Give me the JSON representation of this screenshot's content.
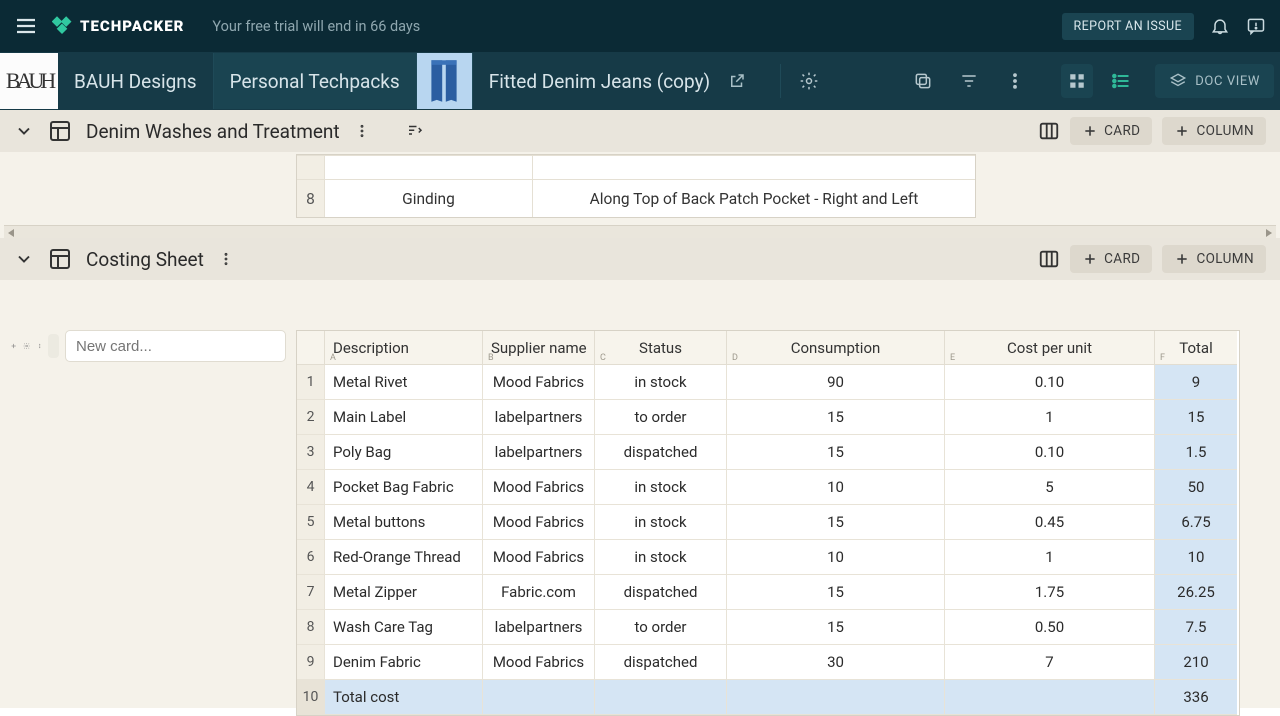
{
  "topbar": {
    "logo": "TECHPACKER",
    "trial": "Your free trial will end in 66 days",
    "report": "REPORT AN ISSUE"
  },
  "nav2": {
    "brand_logo_text": "BAUH",
    "crumb_brand": "BAUH Designs",
    "crumb_collection": "Personal Techpacks",
    "crumb_item": "Fitted Denim Jeans (copy)",
    "doc_view": "DOC VIEW"
  },
  "section1": {
    "title": "Denim Washes and Treatment",
    "card_btn": "CARD",
    "column_btn": "COLUMN",
    "mini_row8_idx": "8",
    "mini_row8_a": "Ginding",
    "mini_row8_b": "Along Top of Back Patch Pocket - Right and Left"
  },
  "section2": {
    "title": "Costing Sheet",
    "card_btn": "CARD",
    "column_btn": "COLUMN",
    "new_card_placeholder": "New card...",
    "headers": {
      "desc": "Description",
      "supp": "Supplier name",
      "stat": "Status",
      "cons": "Consumption",
      "cpu": "Cost per unit",
      "tot": "Total"
    },
    "letters": {
      "desc": "A",
      "supp": "B",
      "stat": "C",
      "cons": "D",
      "cpu": "E",
      "tot": "F"
    },
    "rows": [
      {
        "idx": "1",
        "desc": "Metal Rivet",
        "supp": "Mood Fabrics",
        "stat": "in stock",
        "cons": "90",
        "cpu": "0.10",
        "tot": "9"
      },
      {
        "idx": "2",
        "desc": "Main Label",
        "supp": "labelpartners",
        "stat": "to order",
        "cons": "15",
        "cpu": "1",
        "tot": "15"
      },
      {
        "idx": "3",
        "desc": "Poly Bag",
        "supp": "labelpartners",
        "stat": "dispatched",
        "cons": "15",
        "cpu": "0.10",
        "tot": "1.5"
      },
      {
        "idx": "4",
        "desc": "Pocket Bag Fabric",
        "supp": "Mood Fabrics",
        "stat": "in stock",
        "cons": "10",
        "cpu": "5",
        "tot": "50"
      },
      {
        "idx": "5",
        "desc": "Metal buttons",
        "supp": "Mood Fabrics",
        "stat": "in stock",
        "cons": "15",
        "cpu": "0.45",
        "tot": "6.75"
      },
      {
        "idx": "6",
        "desc": "Red-Orange Thread",
        "supp": "Mood Fabrics",
        "stat": "in stock",
        "cons": "10",
        "cpu": "1",
        "tot": "10"
      },
      {
        "idx": "7",
        "desc": "Metal Zipper",
        "supp": "Fabric.com",
        "stat": "dispatched",
        "cons": "15",
        "cpu": "1.75",
        "tot": "26.25"
      },
      {
        "idx": "8",
        "desc": "Wash Care Tag",
        "supp": "labelpartners",
        "stat": "to order",
        "cons": "15",
        "cpu": "0.50",
        "tot": "7.5"
      },
      {
        "idx": "9",
        "desc": "Denim Fabric",
        "supp": "Mood Fabrics",
        "stat": "dispatched",
        "cons": "30",
        "cpu": "7",
        "tot": "210"
      }
    ],
    "total_row": {
      "idx": "10",
      "desc": "Total cost",
      "tot": "336"
    }
  }
}
